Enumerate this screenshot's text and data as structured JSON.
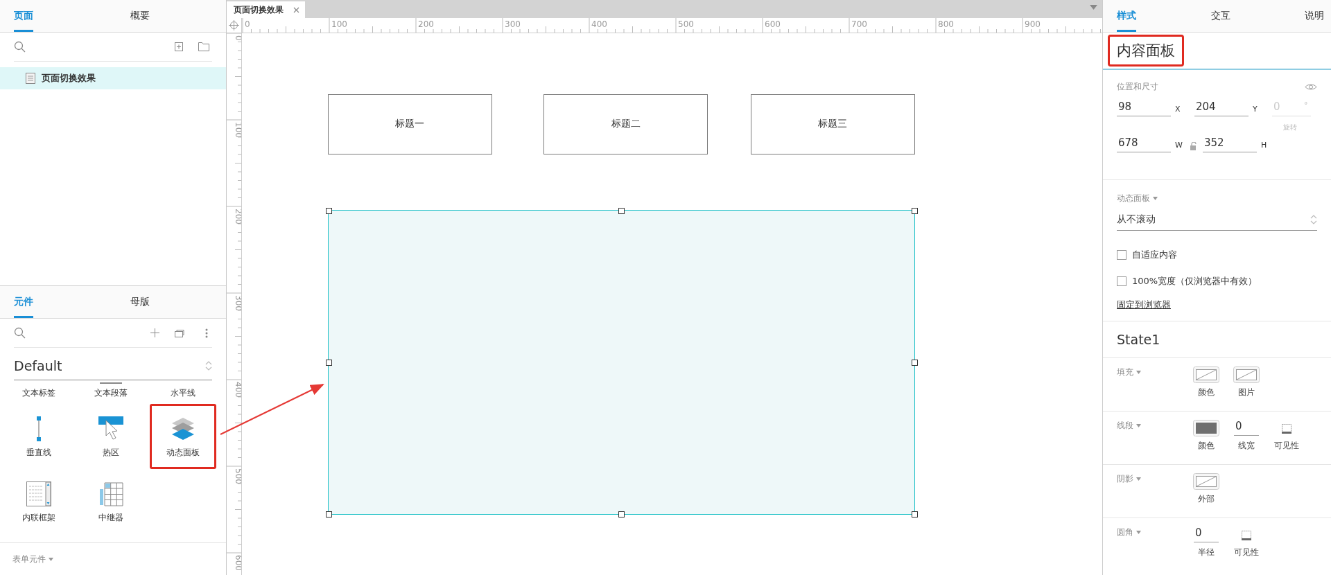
{
  "left_panel": {
    "page_tabs": [
      {
        "label": "页面",
        "selected": true
      },
      {
        "label": "概要",
        "selected": false
      }
    ],
    "pages": [
      {
        "name": "页面切换效果",
        "selected": true
      }
    ],
    "library_tabs": [
      {
        "label": "元件",
        "selected": true
      },
      {
        "label": "母版",
        "selected": false
      }
    ],
    "library": "Default",
    "widgets": [
      {
        "kind": "text_label",
        "label": "文本标签",
        "highlighted": false
      },
      {
        "kind": "text_paragraph",
        "label": "文本段落",
        "highlighted": false
      },
      {
        "kind": "horizontal_line",
        "label": "水平线",
        "highlighted": false
      },
      {
        "kind": "vertical_line",
        "label": "垂直线",
        "highlighted": false
      },
      {
        "kind": "hotspot",
        "label": "热区",
        "highlighted": false
      },
      {
        "kind": "dynamic_panel",
        "label": "动态面板",
        "highlighted": true
      },
      {
        "kind": "inline_frame",
        "label": "内联框架",
        "highlighted": false
      },
      {
        "kind": "repeater",
        "label": "中继器",
        "highlighted": false
      }
    ],
    "footer": "表单元件"
  },
  "document_tabs": [
    {
      "label": "页面切换效果",
      "selected": true
    }
  ],
  "rulers": {
    "x_labels": [
      "0",
      "100",
      "200",
      "300",
      "400",
      "500",
      "600",
      "700",
      "800",
      "900"
    ],
    "y_labels": [
      "0",
      "100",
      "200",
      "300",
      "400",
      "500",
      "600"
    ]
  },
  "canvas": {
    "widgets": [
      {
        "kind": "box",
        "label": "标题一"
      },
      {
        "kind": "box",
        "label": "标题二"
      },
      {
        "kind": "box",
        "label": "标题三"
      },
      {
        "kind": "dynamic_panel",
        "selected": true
      }
    ]
  },
  "inspector": {
    "tabs": [
      {
        "label": "样式",
        "selected": true
      },
      {
        "label": "交互",
        "selected": false
      },
      {
        "label": "说明",
        "selected": false
      }
    ],
    "widget_name": "内容面板",
    "name_highlighted": true,
    "position_title": "位置和尺寸",
    "position_rows": [
      [
        {
          "value": "98",
          "unit": "X",
          "disabled": false
        },
        {
          "value": "204",
          "unit": "Y",
          "disabled": false
        },
        {
          "value": "0",
          "unit": "°",
          "caption": "旋转",
          "disabled": true
        }
      ],
      [
        {
          "value": "678",
          "unit": "W",
          "disabled": false
        },
        {
          "value": "352",
          "unit": "H",
          "disabled": false
        }
      ]
    ],
    "panel_title": "动态面板",
    "scrollbars": "从不滚动",
    "options": [
      {
        "label": "自适应内容",
        "checked": false
      },
      {
        "label": "100%宽度（仅浏览器中有效）",
        "checked": false
      }
    ],
    "pin_link": "固定到浏览器",
    "state": "State1",
    "style_rows": [
      {
        "title": "填充",
        "items": [
          {
            "kind": "swatch",
            "caption": "颜色"
          },
          {
            "kind": "swatch",
            "caption": "图片"
          }
        ]
      },
      {
        "title": "线段",
        "items": [
          {
            "kind": "filled_swatch",
            "caption": "颜色"
          },
          {
            "kind": "number",
            "value": "0",
            "caption": "线宽"
          },
          {
            "kind": "visibility",
            "caption": "可见性"
          }
        ]
      },
      {
        "title": "阴影",
        "items": [
          {
            "kind": "swatch",
            "caption": "外部"
          }
        ]
      },
      {
        "title": "圆角",
        "items": [
          {
            "kind": "number",
            "value": "0",
            "caption": "半径"
          },
          {
            "kind": "visibility",
            "caption": "可见性"
          }
        ]
      }
    ]
  }
}
